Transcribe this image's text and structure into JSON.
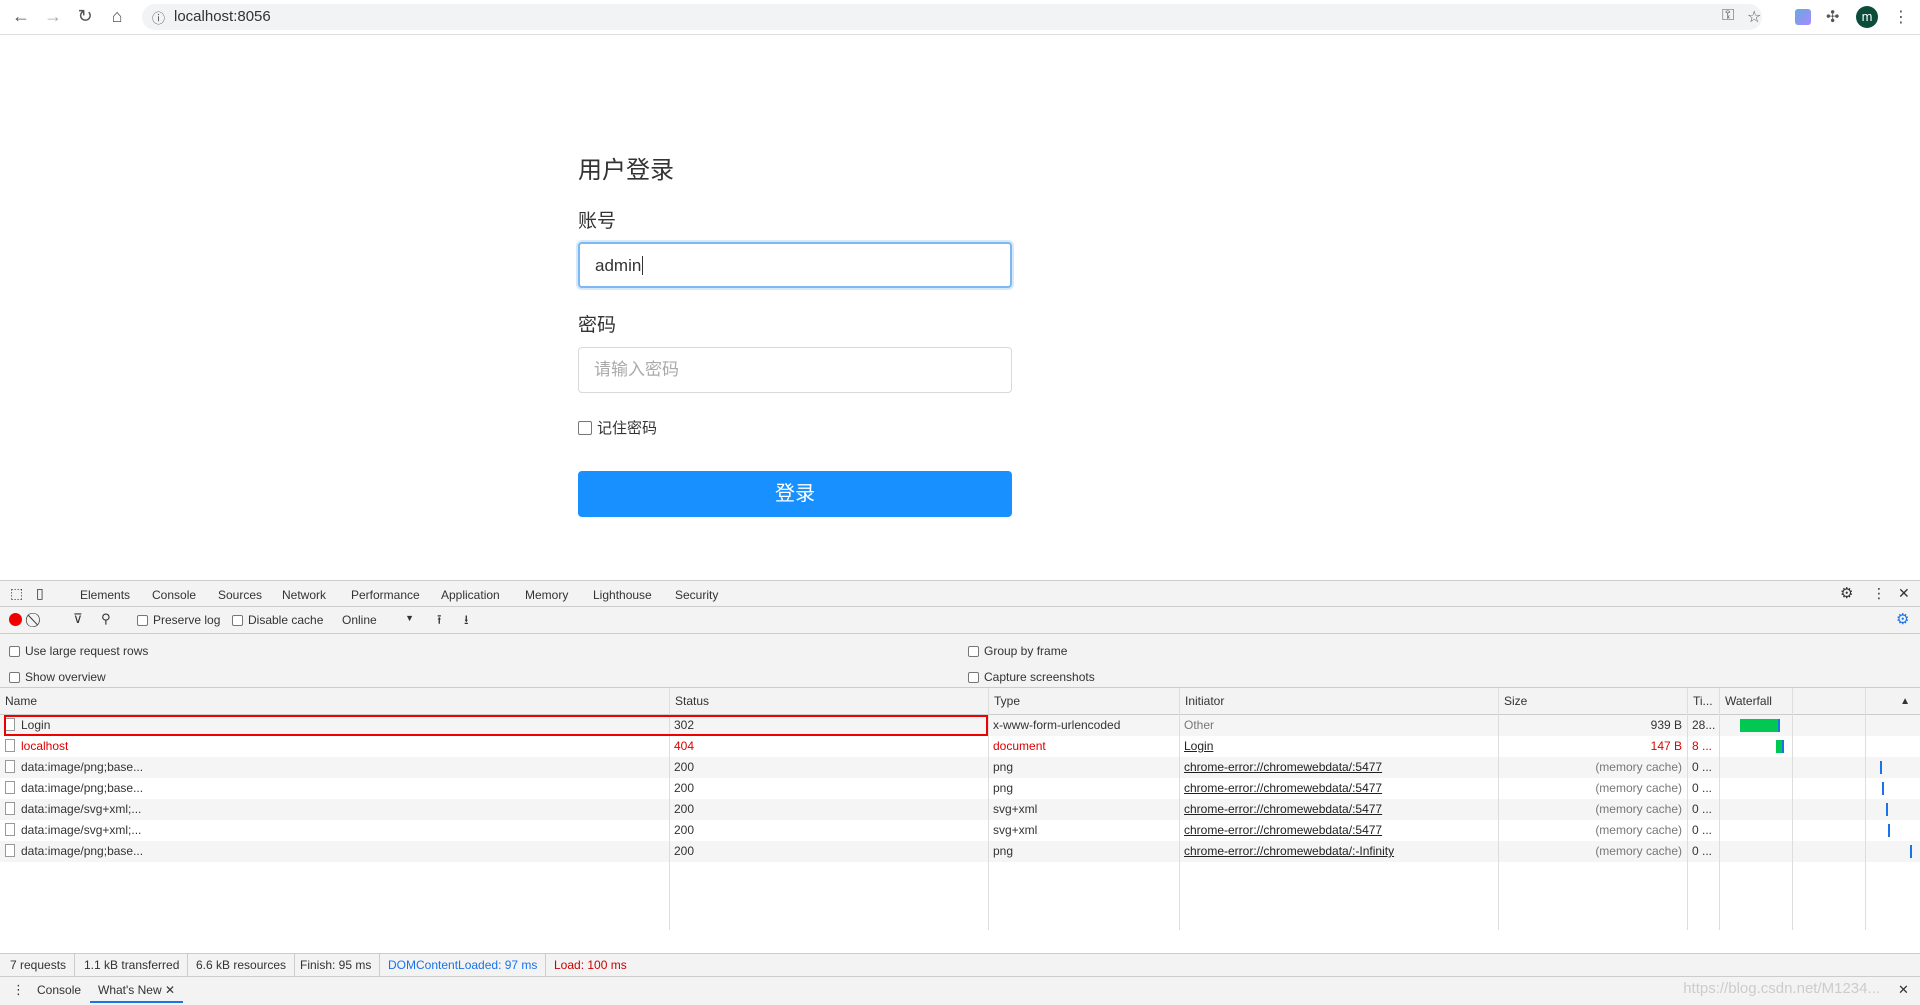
{
  "browser": {
    "url": "localhost:8056",
    "icons": [
      "back-icon",
      "forward-icon",
      "reload-icon",
      "home-icon",
      "info-icon",
      "key-icon",
      "star-icon",
      "extension-app-icon",
      "puzzle-icon",
      "menu-icon"
    ],
    "avatar_letter": "m"
  },
  "form": {
    "title": "用户登录",
    "account_label": "账号",
    "account_value": "admin",
    "password_label": "密码",
    "password_placeholder": "请输入密码",
    "remember_label": "记住密码",
    "submit_label": "登录",
    "accent": "#1890ff"
  },
  "devtools": {
    "tabs": [
      "Elements",
      "Console",
      "Sources",
      "Network",
      "Performance",
      "Application",
      "Memory",
      "Lighthouse",
      "Security"
    ],
    "active_tab": "Network",
    "toolbar": {
      "preserve_log": "Preserve log",
      "disable_cache": "Disable cache",
      "throttle": "Online"
    },
    "options": {
      "large_rows": "Use large request rows",
      "show_overview": "Show overview",
      "group_by_frame": "Group by frame",
      "capture_screenshots": "Capture screenshots"
    },
    "columns": [
      "Name",
      "Status",
      "Type",
      "Initiator",
      "Size",
      "Ti...",
      "Waterfall"
    ],
    "rows": [
      {
        "name": "Login",
        "status": "302",
        "type": "x-www-form-urlencoded",
        "initiator": "Other",
        "size": "939 B",
        "time": "28...",
        "error": false
      },
      {
        "name": "localhost",
        "status": "404",
        "type": "document",
        "initiator": "Login",
        "size": "147 B",
        "time": "8 ...",
        "error": true
      },
      {
        "name": "data:image/png;base...",
        "status": "200",
        "type": "png",
        "initiator": "chrome-error://chromewebdata/:5477",
        "size": "(memory cache)",
        "time": "0 ...",
        "error": false
      },
      {
        "name": "data:image/png;base...",
        "status": "200",
        "type": "png",
        "initiator": "chrome-error://chromewebdata/:5477",
        "size": "(memory cache)",
        "time": "0 ...",
        "error": false
      },
      {
        "name": "data:image/svg+xml;...",
        "status": "200",
        "type": "svg+xml",
        "initiator": "chrome-error://chromewebdata/:5477",
        "size": "(memory cache)",
        "time": "0 ...",
        "error": false
      },
      {
        "name": "data:image/svg+xml;...",
        "status": "200",
        "type": "svg+xml",
        "initiator": "chrome-error://chromewebdata/:5477",
        "size": "(memory cache)",
        "time": "0 ...",
        "error": false
      },
      {
        "name": "data:image/png;base...",
        "status": "200",
        "type": "png",
        "initiator": "chrome-error://chromewebdata/:-Infinity",
        "size": "(memory cache)",
        "time": "0 ...",
        "error": false
      }
    ],
    "summary": {
      "requests": "7 requests",
      "transferred": "1.1 kB transferred",
      "resources": "6.6 kB resources",
      "finish": "Finish: 95 ms",
      "dcl": "DOMContentLoaded: 97 ms",
      "load": "Load: 100 ms"
    },
    "drawer": {
      "console": "Console",
      "whats_new": "What's New"
    }
  },
  "watermark": "https://blog.csdn.net/M1234..."
}
